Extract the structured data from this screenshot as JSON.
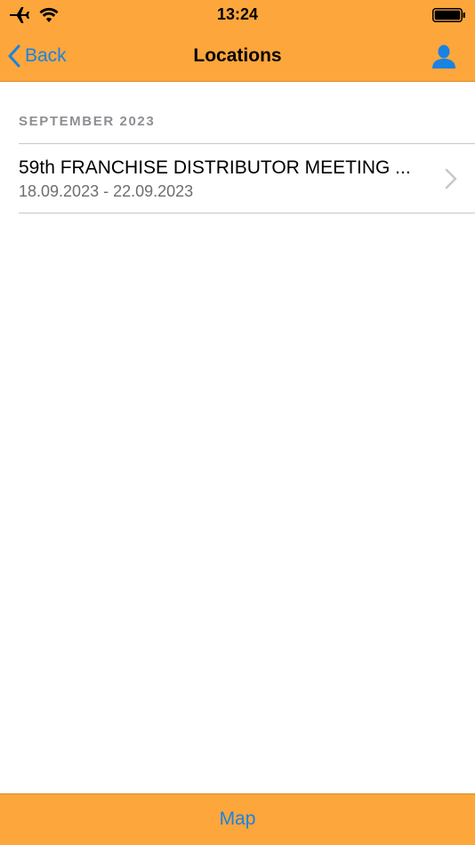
{
  "status_bar": {
    "time": "13:24",
    "icons": [
      "airplane-icon",
      "wifi-icon",
      "battery-icon"
    ]
  },
  "nav_bar": {
    "back_label": "Back",
    "title": "Locations",
    "right_icon": "user-icon"
  },
  "sections": [
    {
      "header": "SEPTEMBER 2023",
      "items": [
        {
          "title": "59th FRANCHISE DISTRIBUTOR MEETING ...",
          "subtitle": "18.09.2023 - 22.09.2023"
        }
      ]
    }
  ],
  "toolbar": {
    "map_label": "Map"
  },
  "colors": {
    "bar_background": "#FCA63C",
    "tint": "#1a82e2",
    "secondary_text": "#6d6d72",
    "section_text": "#8e8e93",
    "separator": "#c8c7cc"
  }
}
